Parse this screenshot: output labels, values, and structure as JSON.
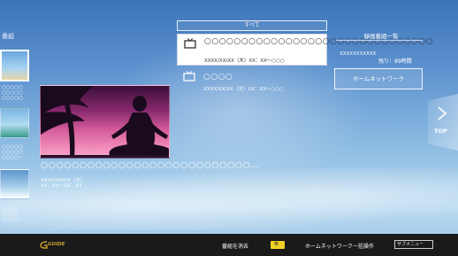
{
  "left": {
    "title": "番組",
    "items": [
      {
        "label": ""
      },
      {
        "label": "○○○○○\n○○○○○\n○○○○○"
      },
      {
        "label": ""
      },
      {
        "label": "○○○○○\n○○○○○\n○○○○−"
      },
      {
        "label": ""
      },
      {
        "label": "○○○○\n○○○○\n○○○○−"
      }
    ]
  },
  "preview": {
    "title": "○○○○○○○○○○○○○○○○○○○○○○○○○○○…",
    "date_line1": "XXXX/XX/XX（木）",
    "date_line2": "XX：XX〜XX：XX"
  },
  "category_tab": "すべて",
  "recordings": [
    {
      "title": "○○○○○○○○○○○○○○○○○○○○○○○○○○○○○○○",
      "date": "XXXX/XX/XX（木）XX：XX〜○○○"
    },
    {
      "title": "○○○○",
      "date": "XXXX/XX/XX（木）XX：XX〜○○○"
    }
  ],
  "right_panel": {
    "title": "録画番組一覧",
    "name": "XXXXXXXXXXX",
    "remaining": "残り：89時間",
    "home_network_button": "ホームネットワーク"
  },
  "top_button": {
    "label": "TOP"
  },
  "bottom_bar": {
    "brand": "GUIDE",
    "delete_label": "番組を消去",
    "yellow_key": "黄",
    "bulk_label": "ホームネットワーク一括操作",
    "submenu": "サブメニュー"
  },
  "colors": {
    "selected_bg": "#ffffff",
    "bottom_bar": "#1a1a1a",
    "yellow_key": "#f0d020",
    "brand": "#c8a12a"
  }
}
